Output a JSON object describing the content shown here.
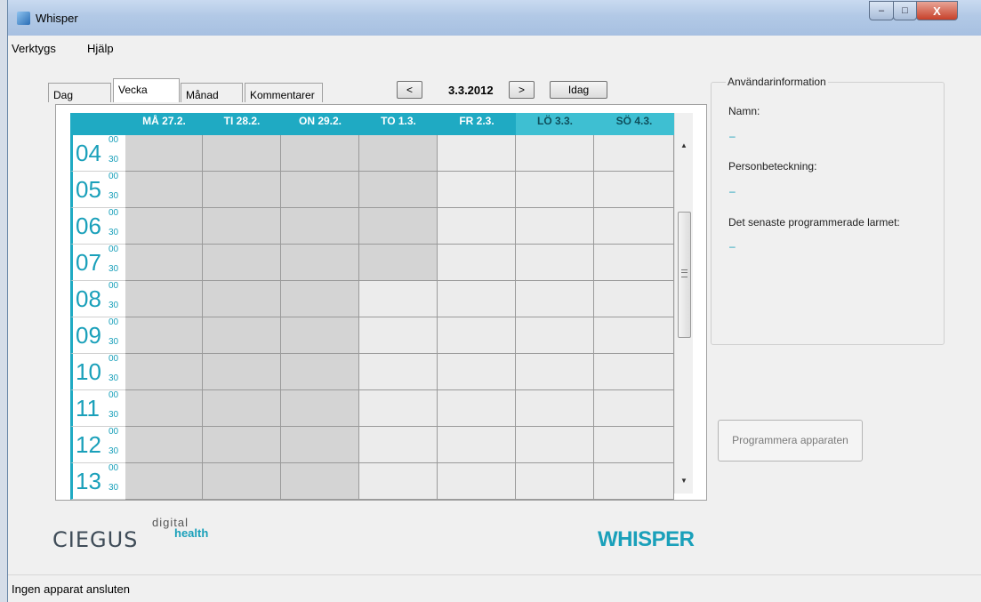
{
  "window": {
    "title": "Whisper",
    "controls": {
      "minimize": "‒",
      "maximize": "□",
      "close": "X"
    }
  },
  "menu": [
    "Verktygs",
    "Hjälp"
  ],
  "tabs": [
    "Dag",
    "Vecka",
    "Månad",
    "Kommentarer"
  ],
  "active_tab": "Vecka",
  "nav": {
    "prev": "<",
    "date": "3.3.2012",
    "next": ">",
    "today": "Idag"
  },
  "calendar": {
    "days": [
      {
        "label": "MÅ 27.2.",
        "weekend": false
      },
      {
        "label": "TI 28.2.",
        "weekend": false
      },
      {
        "label": "ON 29.2.",
        "weekend": false
      },
      {
        "label": "TO 1.3.",
        "weekend": false
      },
      {
        "label": "FR 2.3.",
        "weekend": false
      },
      {
        "label": "LÖ 3.3.",
        "weekend": true
      },
      {
        "label": "SÖ 4.3.",
        "weekend": true
      }
    ],
    "hours": [
      "04",
      "05",
      "06",
      "07",
      "08",
      "09",
      "10",
      "11",
      "12",
      "13"
    ],
    "minute_marks": [
      "00",
      "30"
    ]
  },
  "user_info": {
    "legend": "Användarinformation",
    "name_label": "Namn:",
    "name_value": "–",
    "id_label": "Personbeteckning:",
    "id_value": "–",
    "alarm_label": "Det senaste programmerade larmet:",
    "alarm_value": "–"
  },
  "program_button": "Programmera apparaten",
  "logos": {
    "digital": "digital",
    "ciegus": "CIEGUS",
    "health": "health",
    "whisper": "WHISPER"
  },
  "status": "Ingen apparat ansluten",
  "colors": {
    "accent": "#1faac3",
    "past_cell": "#d4d4d4",
    "future_cell": "#ececec"
  }
}
